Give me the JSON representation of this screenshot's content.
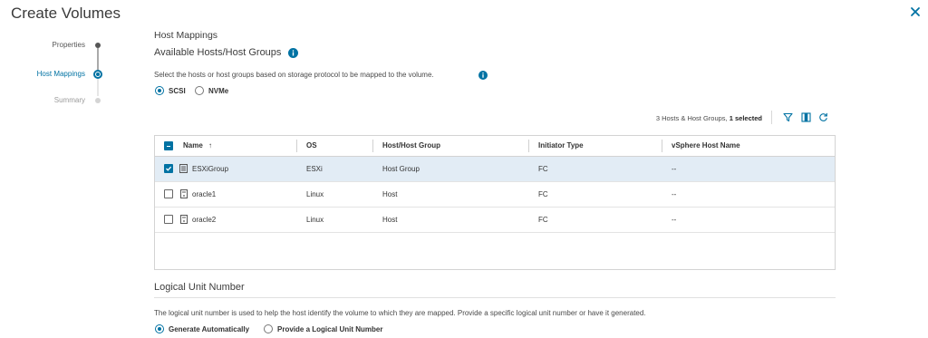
{
  "window": {
    "title": "Create Volumes",
    "close_icon": "close-icon"
  },
  "stepper": {
    "steps": [
      {
        "label": "Properties",
        "state": "done"
      },
      {
        "label": "Host Mappings",
        "state": "active"
      },
      {
        "label": "Summary",
        "state": "todo"
      }
    ]
  },
  "host_mappings": {
    "section_title": "Host Mappings",
    "subtitle": "Available Hosts/Host Groups",
    "description": "Select the hosts or host groups based on storage protocol to be mapped to the volume.",
    "protocol_options": [
      {
        "label": "SCSI",
        "selected": true
      },
      {
        "label": "NVMe",
        "selected": false
      }
    ]
  },
  "toolbar": {
    "count_prefix": "3 Hosts & Host Groups, ",
    "count_selected": "1 selected",
    "icons": [
      "filter-icon",
      "columns-icon",
      "refresh-icon"
    ]
  },
  "grid": {
    "columns": [
      {
        "label": "Name",
        "sort": "ascending"
      },
      {
        "label": "OS"
      },
      {
        "label": "Host/Host Group"
      },
      {
        "label": "Initiator Type"
      },
      {
        "label": "vSphere Host Name"
      }
    ],
    "sort_indicator": "↑",
    "rows": [
      {
        "name": "ESXiGroup",
        "os": "ESXi",
        "type": "Host Group",
        "initiator": "FC",
        "vsphere": "--",
        "selected": true,
        "icon": "host-group-icon"
      },
      {
        "name": "oracle1",
        "os": "Linux",
        "type": "Host",
        "initiator": "FC",
        "vsphere": "--",
        "selected": false,
        "icon": "host-icon"
      },
      {
        "name": "oracle2",
        "os": "Linux",
        "type": "Host",
        "initiator": "FC",
        "vsphere": "--",
        "selected": false,
        "icon": "host-icon"
      }
    ]
  },
  "lun": {
    "section_title": "Logical Unit Number",
    "description": "The logical unit number is used to help the host identify the volume to which they are mapped. Provide a specific logical unit number or have it generated.",
    "options": [
      {
        "label": "Generate Automatically",
        "selected": true
      },
      {
        "label": "Provide a Logical Unit Number",
        "selected": false
      }
    ]
  },
  "colors": {
    "accent": "#0072a3",
    "selected_row": "#e2ecf5",
    "border": "#d3d3d3"
  }
}
